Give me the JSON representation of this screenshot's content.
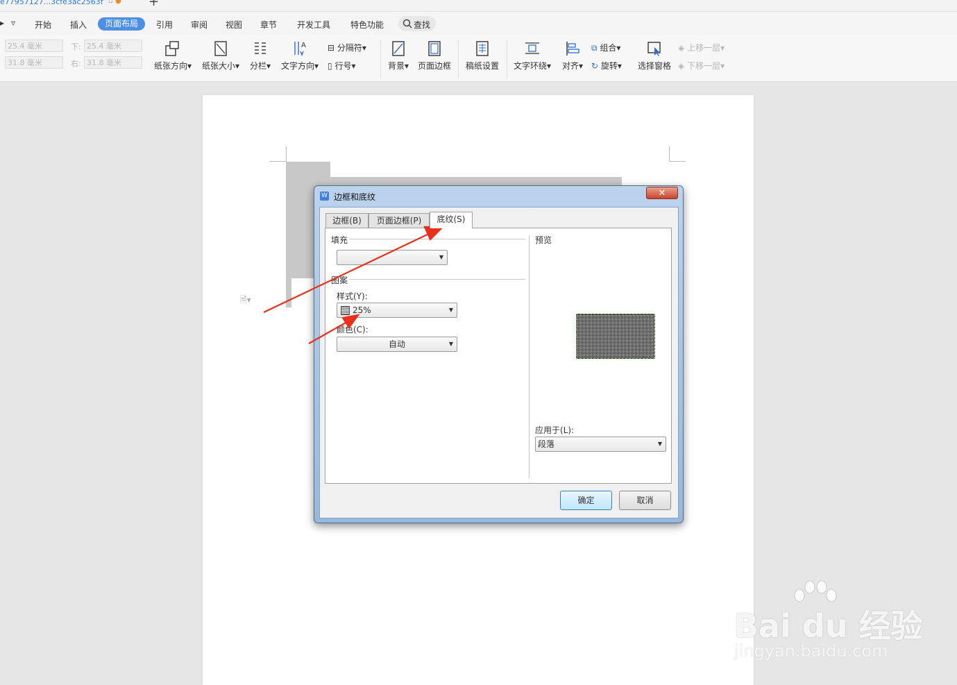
{
  "document_tab": {
    "title": "e77957127...3cfe3ac2563f",
    "new_tab": "+"
  },
  "menu": {
    "items": [
      "开始",
      "插入",
      "页面布局",
      "引用",
      "审阅",
      "视图",
      "章节",
      "开发工具",
      "特色功能"
    ],
    "active": "页面布局",
    "search": "查找",
    "left_glyph": "▿"
  },
  "ribbon": {
    "margins": {
      "top_value": "25.4 毫米",
      "bottom_label": "下:",
      "bottom_value": "25.4 毫米",
      "left_value": "31.8 毫米",
      "right_label": "右:",
      "right_value": "31.8 毫米"
    },
    "buttons": {
      "orientation": "纸张方向",
      "size": "纸张大小",
      "columns": "分栏",
      "text_direction": "文字方向",
      "breaks": "分隔符",
      "line_numbers": "行号",
      "background": "背景",
      "page_border": "页面边框",
      "manuscript": "稿纸设置",
      "text_wrap": "文字环绕",
      "align": "对齐",
      "group": "组合",
      "rotate": "旋转",
      "selection_pane": "选择窗格",
      "bring_forward": "上移一层",
      "send_backward": "下移一层"
    },
    "dropdown_glyph": "▾"
  },
  "dialog": {
    "title": "边框和底纹",
    "close": "✕",
    "tabs": [
      "边框(B)",
      "页面边框(P)",
      "底纹(S)"
    ],
    "selected_tab": "底纹(S)",
    "fill": {
      "label": "填充",
      "value": ""
    },
    "pattern": {
      "label": "图案",
      "style_label": "样式(Y):",
      "style_value": "25%",
      "color_label": "颜色(C):",
      "color_value": "自动"
    },
    "preview": {
      "label": "预览"
    },
    "apply_to": {
      "label": "应用于(L):",
      "value": "段落"
    },
    "ok": "确定",
    "cancel": "取消"
  },
  "watermark": {
    "brand": "Bai du 经验",
    "url": "jingyan.baidu.com"
  },
  "colors": {
    "accent": "#4d8ee6",
    "arrow": "#e8301c",
    "dialog_frame": "#a8c4e4"
  }
}
